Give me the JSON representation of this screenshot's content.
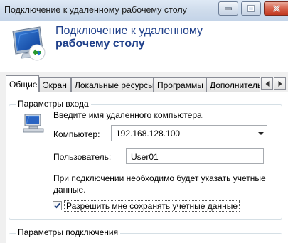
{
  "window": {
    "title": "Подключение к удаленному рабочему столу"
  },
  "header": {
    "line1": "Подключение к удаленному",
    "line2": "рабочему столу"
  },
  "tabs": [
    {
      "label": "Общие",
      "active": true
    },
    {
      "label": "Экран",
      "active": false
    },
    {
      "label": "Локальные ресурсы",
      "active": false
    },
    {
      "label": "Программы",
      "active": false
    },
    {
      "label": "Дополнительно",
      "active": false
    }
  ],
  "login_group": {
    "title": "Параметры входа",
    "hint": "Введите имя удаленного компьютера.",
    "computer_label": "Компьютер:",
    "computer_value": "192.168.128.100",
    "user_label": "Пользователь:",
    "user_value": "User01",
    "note_line1": "При подключении необходимо будет указать учетные",
    "note_line2": "данные.",
    "save_checkbox_label": "Разрешить мне сохранять учетные данные",
    "save_checked": true
  },
  "connection_group": {
    "title": "Параметры подключения"
  },
  "colors": {
    "accent": "#1e3f8a",
    "close_button": "#c23a22"
  }
}
